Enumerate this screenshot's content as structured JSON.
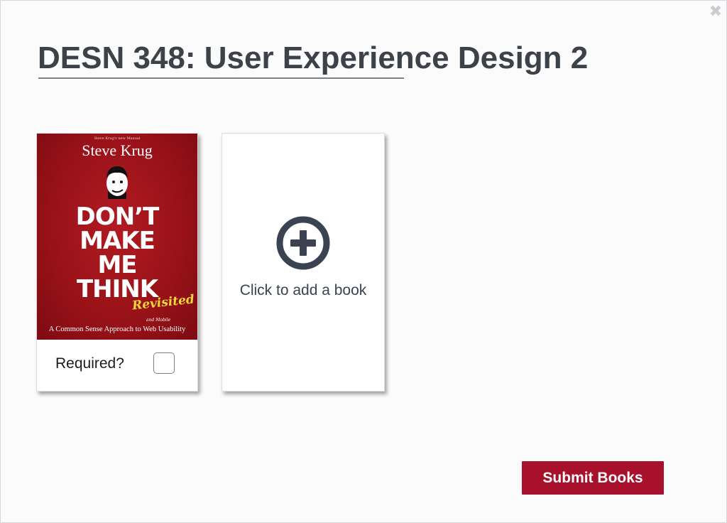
{
  "dialog": {
    "close_symbol": "✖",
    "title": "DESN 348: User Experience Design 2"
  },
  "books": [
    {
      "cover": {
        "blurb_top": "Steve Krug's new Manual",
        "author": "Steve Krug",
        "headline_lines": [
          "DON’T",
          "MAKE",
          "ME",
          "THINK"
        ],
        "revisited": "Revisited",
        "subtitle": "A Common Sense Approach to Web Usability",
        "subtitle_note": "and Mobile",
        "background_color": "#9a1219",
        "accent_color": "#f3d73a"
      },
      "required_label": "Required?",
      "required_checked": false
    }
  ],
  "add_card": {
    "icon": "plus-circle-icon",
    "label": "Click to add a book"
  },
  "submit_label": "Submit Books",
  "colors": {
    "brand": "#a8112c",
    "title_text": "#3d4148",
    "icon": "#3b4251"
  }
}
